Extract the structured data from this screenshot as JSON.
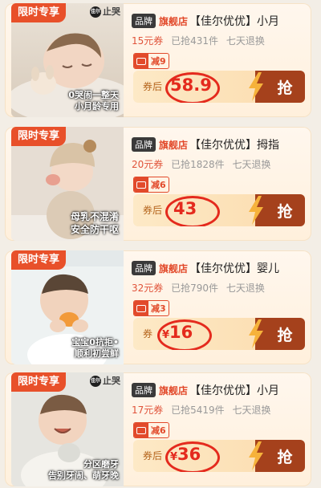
{
  "cards": [
    {
      "tag": "限时专享",
      "stop_cry": "止哭",
      "brand_mark": "佳尔",
      "caption_lines": [
        "0哭闹一整天",
        "小月龄专用"
      ],
      "badge_brand": "品牌",
      "badge_flagship": "旗舰店",
      "title": "【佳尔优优】小月",
      "coupon": "15元券",
      "sold": "已抢431件",
      "returns": "七天退换",
      "discount": "减9",
      "after_label": "券后",
      "currency": "",
      "price": "58.9",
      "grab": "抢"
    },
    {
      "tag": "限时专享",
      "stop_cry": "",
      "brand_mark": "",
      "caption_lines": [
        "母乳不混淆",
        "安全防干呕"
      ],
      "badge_brand": "品牌",
      "badge_flagship": "旗舰店",
      "title": "【佳尔优优】拇指",
      "coupon": "20元券",
      "sold": "已抢1828件",
      "returns": "七天退换",
      "discount": "减6",
      "after_label": "券后",
      "currency": "",
      "price": "43",
      "grab": "抢"
    },
    {
      "tag": "限时专享",
      "stop_cry": "",
      "brand_mark": "",
      "caption_lines": [
        "宝宝0抗拒•",
        "顺利初尝鲜"
      ],
      "badge_brand": "品牌",
      "badge_flagship": "旗舰店",
      "title": "【佳尔优优】婴儿",
      "coupon": "32元券",
      "sold": "已抢790件",
      "returns": "七天退换",
      "discount": "减3",
      "after_label": "券",
      "currency": "¥",
      "price": "16",
      "grab": "抢"
    },
    {
      "tag": "限时专享",
      "stop_cry": "止哭",
      "brand_mark": "佳尔",
      "caption_lines": [
        "分区磨牙",
        "告别牙闹、萌牙晚"
      ],
      "badge_brand": "品牌",
      "badge_flagship": "旗舰店",
      "title": "【佳尔优优】小月",
      "coupon": "17元券",
      "sold": "已抢5419件",
      "returns": "七天退换",
      "discount": "减6",
      "after_label": "券后",
      "currency": "¥",
      "price": "36",
      "grab": "抢"
    }
  ],
  "colors": {
    "accent_red": "#e24a2b",
    "grab_button": "#a5411c",
    "price_red": "#e42a1d"
  }
}
